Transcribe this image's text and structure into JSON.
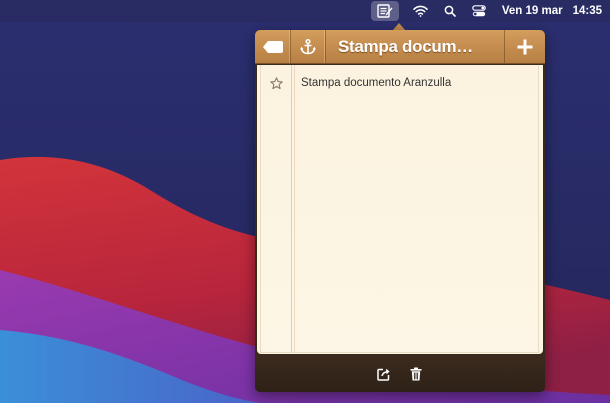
{
  "menubar": {
    "date": "Ven 19 mar",
    "time": "14:35",
    "icons": [
      "notes-app-icon",
      "wifi-icon",
      "search-icon",
      "control-center-icon"
    ]
  },
  "popover": {
    "title": "Stampa docum…",
    "toolbar_icons": [
      "back-icon",
      "anchor-icon",
      "add-icon"
    ],
    "note": {
      "starred": false,
      "text": "Stampa documento Aranzulla"
    },
    "bottom_icons": [
      "share-icon",
      "trash-icon"
    ]
  },
  "colors": {
    "toolbar": "#c08a4e",
    "paper": "#fdf6e3",
    "bottombar": "#33251a"
  }
}
